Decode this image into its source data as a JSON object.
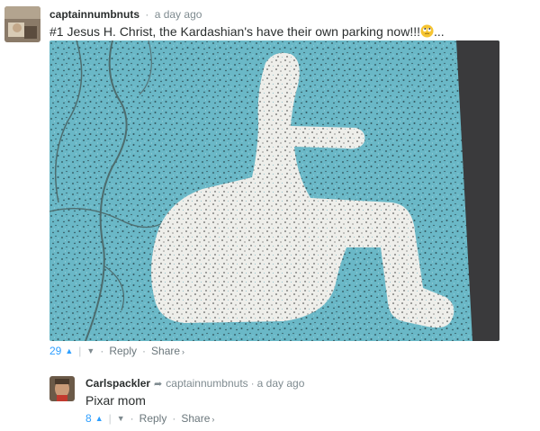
{
  "comments": [
    {
      "author": "captainnumbnuts",
      "time": "a day ago",
      "text": "#1 Jesus H. Christ, the Kardashian's have their own parking now!!!",
      "trailing": "...",
      "votes": "29",
      "reply_label": "Reply",
      "share_label": "Share"
    },
    {
      "author": "Carlspackler",
      "replying_to": "captainnumbnuts",
      "time": "a day ago",
      "text": "Pixar mom",
      "votes": "8",
      "reply_label": "Reply",
      "share_label": "Share"
    }
  ],
  "icons": {
    "upvote": "chevron-up-icon",
    "downvote": "chevron-down-icon",
    "reply_arrow": "reply-arrow-icon",
    "share_caret": "chevron-right-icon",
    "emoji": "rolling-eyes-emoji"
  },
  "colors": {
    "vote_accent": "#2e9fff",
    "meta_gray": "#7f8b90",
    "parking_paint": "#6ab8c7"
  }
}
